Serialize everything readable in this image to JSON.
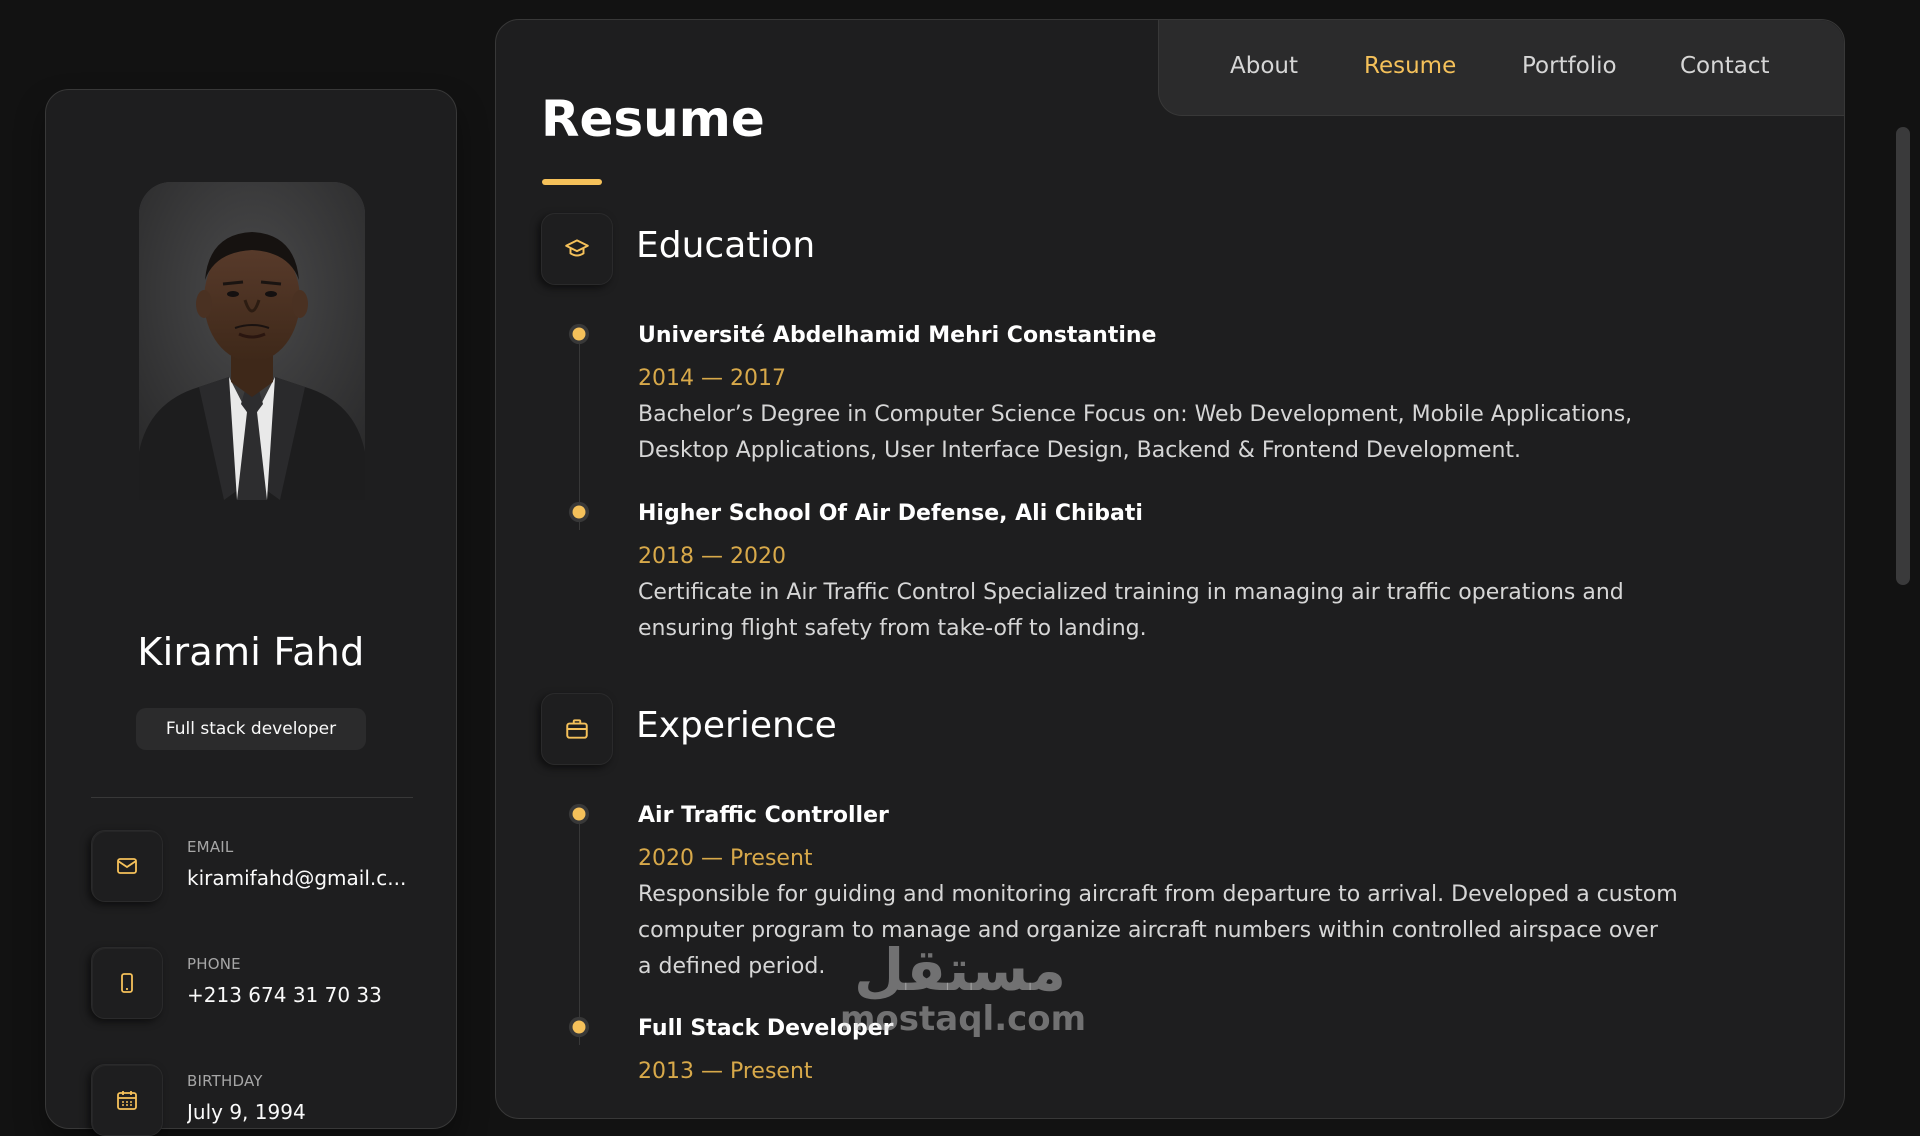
{
  "profile": {
    "name": "Kirami Fahd",
    "title": "Full stack developer"
  },
  "contacts": [
    {
      "label": "EMAIL",
      "value": "kiramifahd@gmail.c...",
      "icon": "mail-icon"
    },
    {
      "label": "PHONE",
      "value": "+213 674 31 70 33",
      "icon": "phone-icon"
    },
    {
      "label": "BIRTHDAY",
      "value": "July 9, 1994",
      "icon": "calendar-icon"
    }
  ],
  "nav": {
    "items": [
      "About",
      "Resume",
      "Portfolio",
      "Contact"
    ],
    "active": "Resume"
  },
  "page": {
    "title": "Resume"
  },
  "education": {
    "title": "Education",
    "icon": "graduation-cap-icon",
    "items": [
      {
        "title": "Université Abdelhamid Mehri Constantine",
        "date": "2014 — 2017",
        "text": "Bachelor’s Degree in Computer Science Focus on: Web Development, Mobile Applications, Desktop Applications, User Interface Design, Backend & Frontend Development."
      },
      {
        "title": "Higher School Of Air Defense, Ali Chibati",
        "date": "2018 — 2020",
        "text": "Certificate in Air Traffic Control Specialized training in managing air traffic operations and ensuring flight safety from take-off to landing."
      }
    ]
  },
  "experience": {
    "title": "Experience",
    "icon": "briefcase-icon",
    "items": [
      {
        "title": "Air Traffic Controller",
        "date": "2020 — Present",
        "text": "Responsible for guiding and monitoring aircraft from departure to arrival. Developed a custom computer program to manage and organize aircraft numbers within controlled airspace over a defined period."
      },
      {
        "title": "Full Stack Developer",
        "date": "2013 — Present"
      }
    ]
  },
  "watermark": {
    "arabic": "مستقل",
    "latin": "mostaql.com"
  },
  "colors": {
    "accent": "#f5c15a",
    "panel": "#1e1e1f",
    "background": "#121212"
  }
}
